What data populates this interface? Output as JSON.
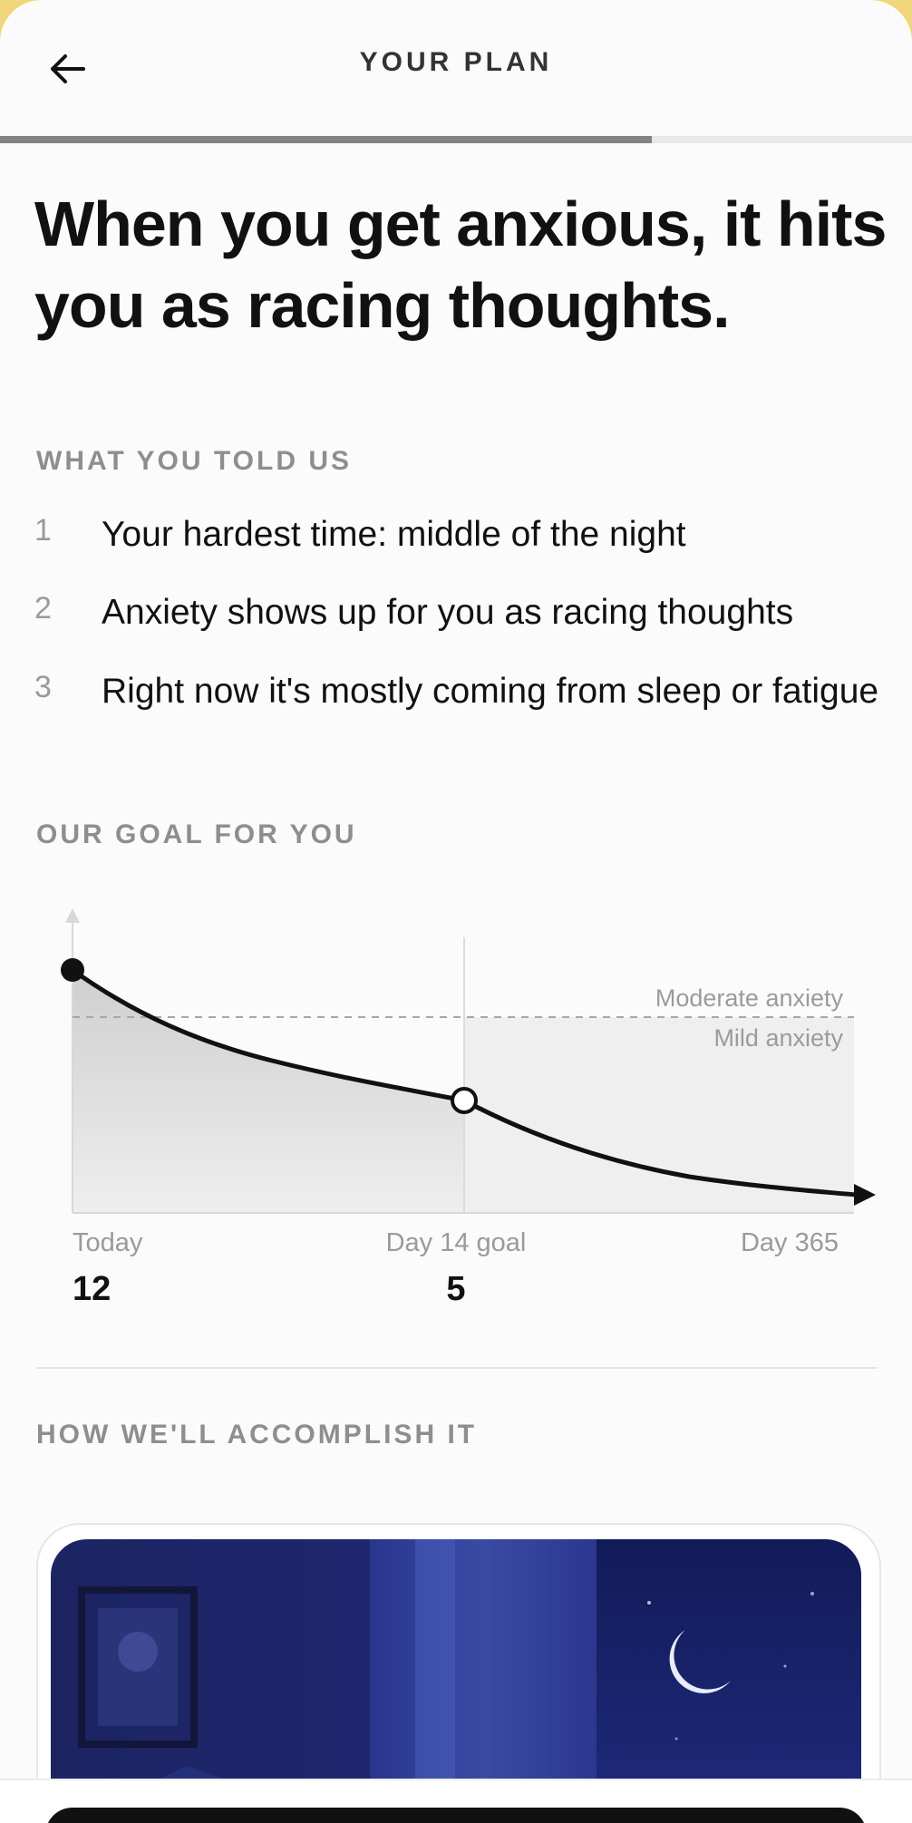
{
  "header": {
    "title": "YOUR PLAN",
    "back_icon": "arrow-left-icon"
  },
  "progress": {
    "fraction": 0.715
  },
  "headline": "When you get anxious, it hits you as racing thoughts.",
  "told": {
    "label": "WHAT YOU TOLD US",
    "items": [
      {
        "num": "1",
        "text": "Your hardest time: middle of the night"
      },
      {
        "num": "2",
        "text": "Anxiety shows up for you as racing thoughts"
      },
      {
        "num": "3",
        "text": "Right now it's mostly coming from sleep or fatigue"
      }
    ]
  },
  "goal": {
    "label": "OUR GOAL FOR YOU"
  },
  "chart_data": {
    "type": "line",
    "thresholds": [
      {
        "label": "Moderate anxiety"
      },
      {
        "label": "Mild anxiety"
      }
    ],
    "points": [
      {
        "label": "Today",
        "value": "12"
      },
      {
        "label": "Day 14 goal",
        "value": "5"
      },
      {
        "label": "Day 365",
        "value": ""
      }
    ],
    "grid": false
  },
  "accomplish": {
    "label": "HOW WE'LL ACCOMPLISH IT"
  },
  "colors": {
    "accent_bg": "#f2d77a",
    "night_sky": "#1b2470",
    "text": "#111111"
  }
}
